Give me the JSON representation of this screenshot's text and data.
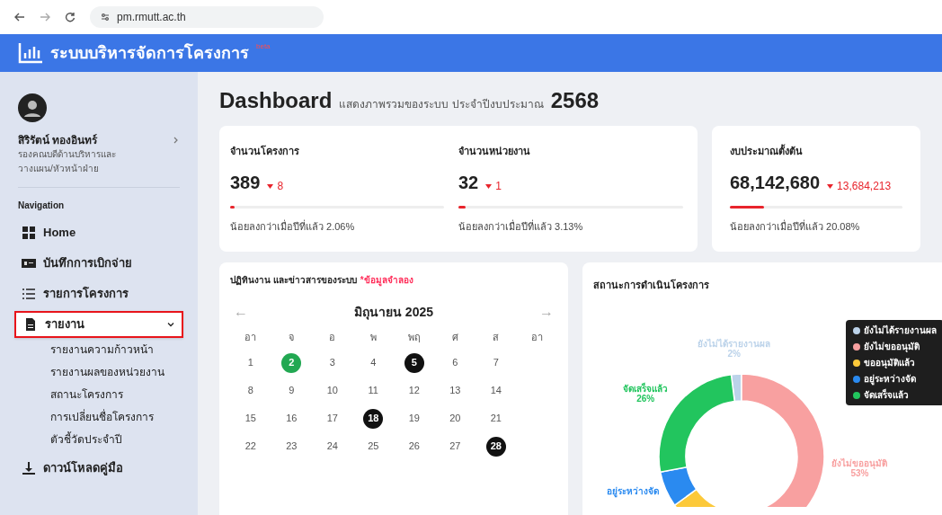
{
  "browser": {
    "url": "pm.rmutt.ac.th"
  },
  "header": {
    "title": "ระบบบริหารจัดการโครงการ",
    "badge": "beta"
  },
  "user": {
    "name": "สิริรัตน์ ทองอินทร์",
    "role": "รองคณบดีด้านบริหารและวางแผน/หัวหน้าฝ่าย"
  },
  "sidebar": {
    "heading": "Navigation",
    "items": [
      {
        "kind": "home",
        "label": "Home",
        "highlighted": false
      },
      {
        "kind": "expense",
        "label": "บันทึกการเบิกจ่าย",
        "highlighted": false
      },
      {
        "kind": "list",
        "label": "รายการโครงการ",
        "highlighted": false
      },
      {
        "kind": "report",
        "label": "รายงาน",
        "highlighted": true,
        "expanded": true,
        "children": [
          {
            "label": "รายงานความก้าวหน้า"
          },
          {
            "label": "รายงานผลของหน่วยงาน"
          },
          {
            "label": "สถานะโครงการ"
          },
          {
            "label": "การเปลี่ยนชื่อโครงการ"
          },
          {
            "label": "ตัวชี้วัดประจำปี"
          }
        ]
      },
      {
        "kind": "download",
        "label": "ดาวน์โหลดคู่มือ",
        "highlighted": false
      }
    ]
  },
  "page": {
    "title": "Dashboard",
    "subtitle": "แสดงภาพรวมของระบบ ประจำปีงบประมาณ",
    "year": "2568"
  },
  "stats": [
    {
      "label": "จำนวนโครงการ",
      "value": "389",
      "change": "8",
      "level": 0.02,
      "note": "น้อยลงกว่าเมื่อปีที่แล้ว 2.06%"
    },
    {
      "label": "จำนวนหน่วยงาน",
      "value": "32",
      "change": "1",
      "level": 0.03,
      "note": "น้อยลงกว่าเมื่อปีที่แล้ว 3.13%"
    },
    {
      "label": "งบประมาณตั้งต้น",
      "value": "68,142,680",
      "change": "13,684,213",
      "level": 0.2,
      "note": "น้อยลงกว่าเมื่อปีที่แล้ว 20.08%"
    }
  ],
  "calendar": {
    "title": "ปฏิทินงาน และข่าวสารของระบบ",
    "title_note": "*ข้อมูลจำลอง",
    "month": "มิถุนายน 2025",
    "prev": "←",
    "next": "→",
    "weekdays": [
      "อา",
      "จ",
      "อ",
      "พ",
      "พฤ",
      "ศ",
      "ส",
      "อา"
    ],
    "weeks": [
      [
        {
          "day": "1"
        },
        {
          "day": "2",
          "color": "#22a852"
        },
        {
          "day": "3"
        },
        {
          "day": "4"
        },
        {
          "day": "5",
          "color": "#111111"
        },
        {
          "day": "6"
        },
        {
          "day": "7"
        }
      ],
      [
        {
          "day": "8"
        },
        {
          "day": "9"
        },
        {
          "day": "10"
        },
        {
          "day": "11"
        },
        {
          "day": "12"
        },
        {
          "day": "13"
        },
        {
          "day": "14"
        }
      ],
      [
        {
          "day": "15"
        },
        {
          "day": "16"
        },
        {
          "day": "17"
        },
        {
          "day": "18",
          "color": "#111111"
        },
        {
          "day": "19"
        },
        {
          "day": "20"
        },
        {
          "day": "21"
        }
      ],
      [
        {
          "day": "22"
        },
        {
          "day": "23"
        },
        {
          "day": "24"
        },
        {
          "day": "25"
        },
        {
          "day": "26"
        },
        {
          "day": "27"
        },
        {
          "day": "28",
          "color": "#111111"
        }
      ]
    ]
  },
  "status_chart": {
    "title": "สถานะการดำเนินโครงการ",
    "legend": [
      {
        "label": "ยังไม่ได้รายงานผล",
        "color": "#bcd3ea"
      },
      {
        "label": "ยังไม่ขออนุมัติ",
        "color": "#f8a0a0"
      },
      {
        "label": "ขออนุมัติแล้ว",
        "color": "#fcc93a"
      },
      {
        "label": "อยู่ระหว่างจัด",
        "color": "#2a8af0"
      },
      {
        "label": "จัดเสร็จแล้ว",
        "color": "#22c55e"
      }
    ],
    "slice_labels": [
      {
        "label": "ยังไม่ได้รายงานผล",
        "percent": "2%",
        "color": "#bcd3ea"
      },
      {
        "label": "จัดเสร็จแล้ว",
        "percent": "26%",
        "color": "#22c55e"
      },
      {
        "label": "ยังไม่ขออนุมัติ",
        "percent": "53%",
        "color": "#f8a0a0"
      },
      {
        "label": "อยู่ระหว่างจัด",
        "color": "#2a8af0"
      }
    ],
    "chart_data": {
      "type": "donut",
      "values": [
        2,
        53,
        12,
        7,
        26
      ]
    }
  }
}
